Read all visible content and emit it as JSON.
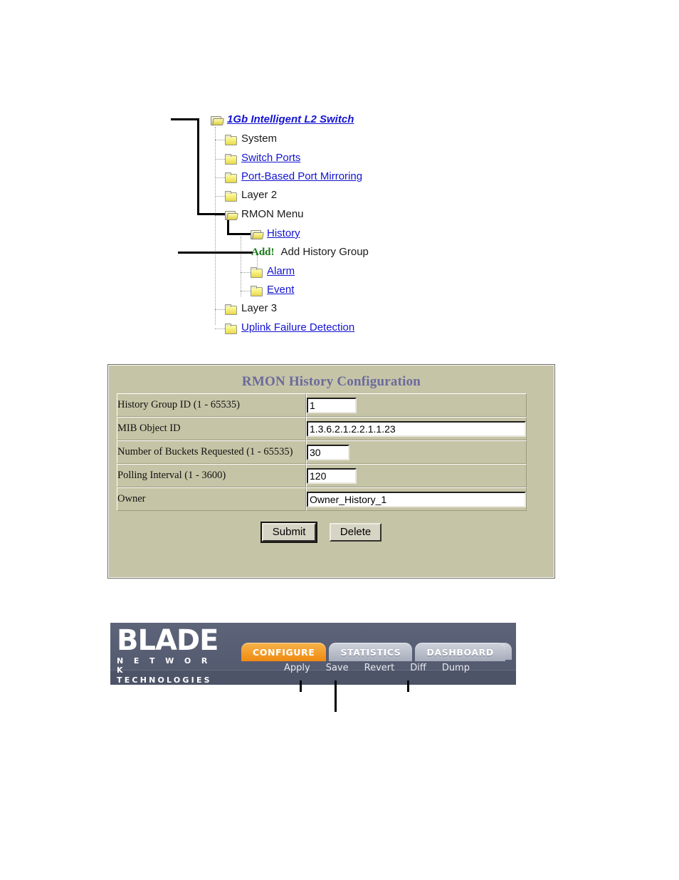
{
  "nav_tree": {
    "items": [
      {
        "label": "1Gb Intelligent L2 Switch",
        "style": "root",
        "icon": "open-folder-icon",
        "depth": 0,
        "link": true
      },
      {
        "label": "System",
        "style": "plain",
        "icon": "closed-folder-icon",
        "depth": 1,
        "link": false
      },
      {
        "label": "Switch Ports",
        "style": "link",
        "icon": "closed-folder-icon",
        "depth": 1,
        "link": true
      },
      {
        "label": "Port-Based Port Mirroring",
        "style": "link",
        "icon": "closed-folder-icon",
        "depth": 1,
        "link": true
      },
      {
        "label": "Layer 2",
        "style": "plain",
        "icon": "closed-folder-icon",
        "depth": 1,
        "link": false
      },
      {
        "label": "RMON Menu",
        "style": "plain",
        "icon": "open-folder-icon",
        "depth": 1,
        "link": false
      },
      {
        "label": "History",
        "style": "link",
        "icon": "open-folder-icon",
        "depth": 2,
        "link": true
      },
      {
        "label": "Add History Group",
        "badge": "Add!",
        "style": "plain",
        "icon": "add-bang-icon",
        "depth": 3,
        "link": false
      },
      {
        "label": "Alarm",
        "style": "link",
        "icon": "closed-folder-icon",
        "depth": 2,
        "link": true
      },
      {
        "label": "Event",
        "style": "link",
        "icon": "closed-folder-icon",
        "depth": 2,
        "link": true
      },
      {
        "label": "Layer 3",
        "style": "plain",
        "icon": "closed-folder-icon",
        "depth": 1,
        "link": false
      },
      {
        "label": "Uplink Failure Detection",
        "style": "link",
        "icon": "closed-folder-icon",
        "depth": 1,
        "link": true
      }
    ]
  },
  "config_panel": {
    "title": "RMON History Configuration",
    "rows": [
      {
        "label": "History Group ID (1 - 65535)",
        "value": "1"
      },
      {
        "label": "MIB Object ID",
        "value": "1.3.6.2.1.2.2.1.1.23"
      },
      {
        "label": "Number of Buckets Requested (1 - 65535)",
        "value": "30"
      },
      {
        "label": "Polling Interval (1 - 3600)",
        "value": "120"
      },
      {
        "label": "Owner",
        "value": "Owner_History_1"
      }
    ],
    "buttons": {
      "submit_label": "Submit",
      "delete_label": "Delete"
    },
    "colors": {
      "panel_background": "#c6c4a6",
      "title_text": "#6a6a9e"
    }
  },
  "blade_banner": {
    "logo": {
      "word": "BLADE",
      "sub_line_1": "N E T W O R K",
      "sub_line_2": "TECHNOLOGIES"
    },
    "tabs": [
      {
        "label": "CONFIGURE",
        "active": true
      },
      {
        "label": "STATISTICS",
        "active": false
      },
      {
        "label": "DASHBOARD",
        "active": false
      }
    ],
    "actions": [
      "Apply",
      "Save",
      "Revert",
      "Diff",
      "Dump"
    ],
    "colors": {
      "banner_background": "#5a6177",
      "active_tab": "#ef8a12",
      "inactive_tab": "#b4b9c6"
    }
  }
}
